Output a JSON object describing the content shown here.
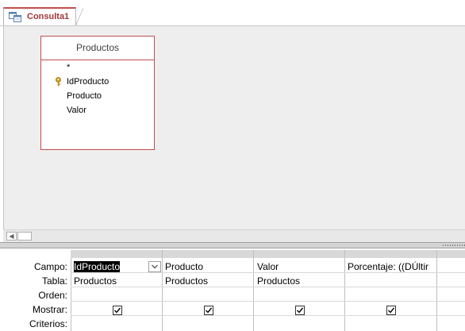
{
  "tab": {
    "label": "Consulta1",
    "icon": "query-design-icon"
  },
  "table": {
    "title": "Productos",
    "fields": [
      {
        "label": "*"
      },
      {
        "label": "IdProducto",
        "primary_key": true
      },
      {
        "label": "Producto"
      },
      {
        "label": "Valor"
      }
    ]
  },
  "grid": {
    "row_labels": {
      "campo": "Campo:",
      "tabla": "Tabla:",
      "orden": "Orden:",
      "mostrar": "Mostrar:",
      "criterios": "Criterios:"
    },
    "columns": [
      {
        "campo": "IdProducto",
        "tabla": "Productos",
        "mostrar": true
      },
      {
        "campo": "Producto",
        "tabla": "Productos",
        "mostrar": true
      },
      {
        "campo": "Valor",
        "tabla": "Productos",
        "mostrar": true
      },
      {
        "campo": "Porcentaje: ((DÚltir",
        "tabla": "",
        "mostrar": true
      }
    ]
  },
  "colors": {
    "accent": "#c0504d",
    "tab_text": "#a4373a",
    "design_bg": "#eeeeee"
  }
}
